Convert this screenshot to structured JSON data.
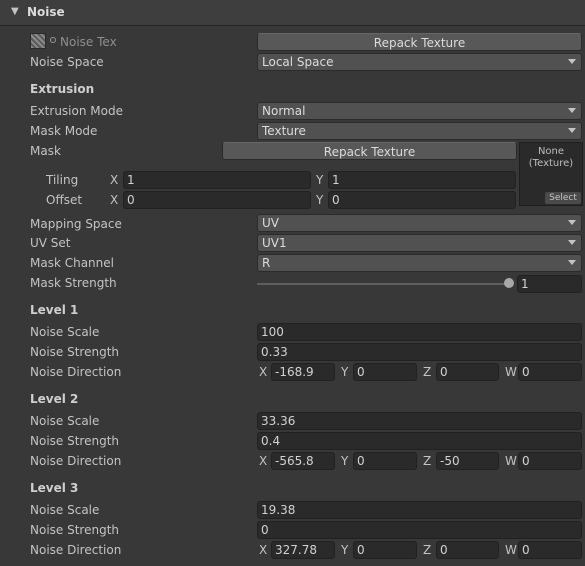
{
  "header": {
    "title": "Noise"
  },
  "noise_tex": {
    "label": "Noise Tex",
    "repack_label": "Repack Texture"
  },
  "noise_space": {
    "label": "Noise Space",
    "value": "Local Space"
  },
  "extrusion": {
    "heading": "Extrusion",
    "mode_label": "Extrusion Mode",
    "mode_value": "Normal",
    "mask_mode_label": "Mask Mode",
    "mask_mode_value": "Texture",
    "mask_label": "Mask",
    "repack_label": "Repack Texture",
    "texture_none": "None\n(Texture)",
    "select_label": "Select",
    "tiling_label": "Tiling",
    "tiling_x": "1",
    "tiling_y": "1",
    "offset_label": "Offset",
    "offset_x": "0",
    "offset_y": "0",
    "axis_x": "X",
    "axis_y": "Y",
    "mapping_label": "Mapping Space",
    "mapping_value": "UV",
    "uvset_label": "UV Set",
    "uvset_value": "UV1",
    "channel_label": "Mask Channel",
    "channel_value": "R",
    "strength_label": "Mask Strength",
    "strength_value": "1",
    "strength_fraction": 1.0
  },
  "axes": {
    "x": "X",
    "y": "Y",
    "z": "Z",
    "w": "W"
  },
  "levels": [
    {
      "heading": "Level 1",
      "scale_label": "Noise Scale",
      "scale": "100",
      "strength_label": "Noise Strength",
      "strength": "0.33",
      "direction_label": "Noise Direction",
      "dx": "-168.9",
      "dy": "0",
      "dz": "0",
      "dw": "0"
    },
    {
      "heading": "Level 2",
      "scale_label": "Noise Scale",
      "scale": "33.36",
      "strength_label": "Noise Strength",
      "strength": "0.4",
      "direction_label": "Noise Direction",
      "dx": "-565.8",
      "dy": "0",
      "dz": "-50",
      "dw": "0"
    },
    {
      "heading": "Level 3",
      "scale_label": "Noise Scale",
      "scale": "19.38",
      "strength_label": "Noise Strength",
      "strength": "0",
      "direction_label": "Noise Direction",
      "dx": "327.78",
      "dy": "0",
      "dz": "0",
      "dw": "0"
    }
  ]
}
